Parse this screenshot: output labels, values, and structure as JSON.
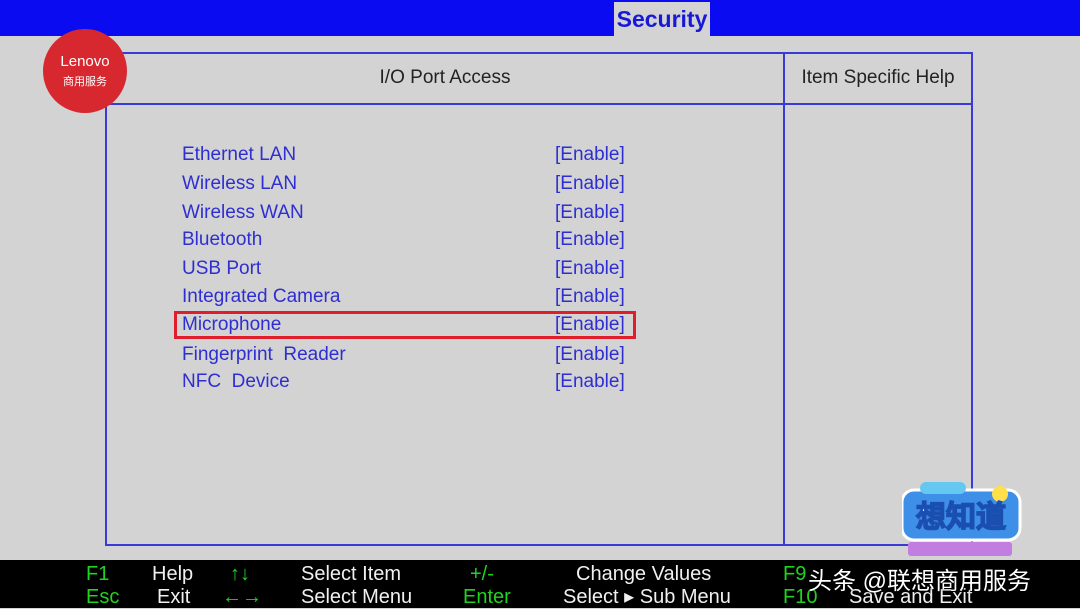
{
  "header": {
    "active_tab": "Security"
  },
  "logo": {
    "brand": "Lenovo",
    "subtitle": "商用服务"
  },
  "main": {
    "title": "I/O Port Access",
    "help_title": "Item Specific Help",
    "items": [
      {
        "label": "Ethernet LAN",
        "value": "[Enable]"
      },
      {
        "label": "Wireless LAN",
        "value": "[Enable]"
      },
      {
        "label": "Wireless WAN",
        "value": "[Enable]"
      },
      {
        "label": "Bluetooth",
        "value": "[Enable]"
      },
      {
        "label": "USB Port",
        "value": "[Enable]"
      },
      {
        "label": "Integrated Camera",
        "value": "[Enable]"
      },
      {
        "label": "Microphone",
        "value": "[Enable]"
      },
      {
        "label": "Fingerprint  Reader",
        "value": "[Enable]"
      },
      {
        "label": "NFC  Device",
        "value": "[Enable]"
      }
    ],
    "highlighted_index": 6
  },
  "footer": {
    "f1": "F1",
    "help": "Help",
    "updown": "↑↓",
    "select_item": "Select Item",
    "plusminus": "+/-",
    "change_values": "Change Values",
    "f9": "F9",
    "esc": "Esc",
    "exit": "Exit",
    "leftright": "←→",
    "select_menu": "Select Menu",
    "enter": "Enter",
    "select_sub_menu": "Select ▸ Sub Menu",
    "f10": "F10",
    "save_exit": "Save and Exit"
  },
  "badge": {
    "text": "想知道"
  },
  "watermark": {
    "text": "头条 @联想商用服务"
  },
  "colors": {
    "accent_blue": "#0b0bf2",
    "item_blue": "#2e2ed2",
    "highlight_red": "#e01e2b",
    "key_green": "#21d321"
  }
}
